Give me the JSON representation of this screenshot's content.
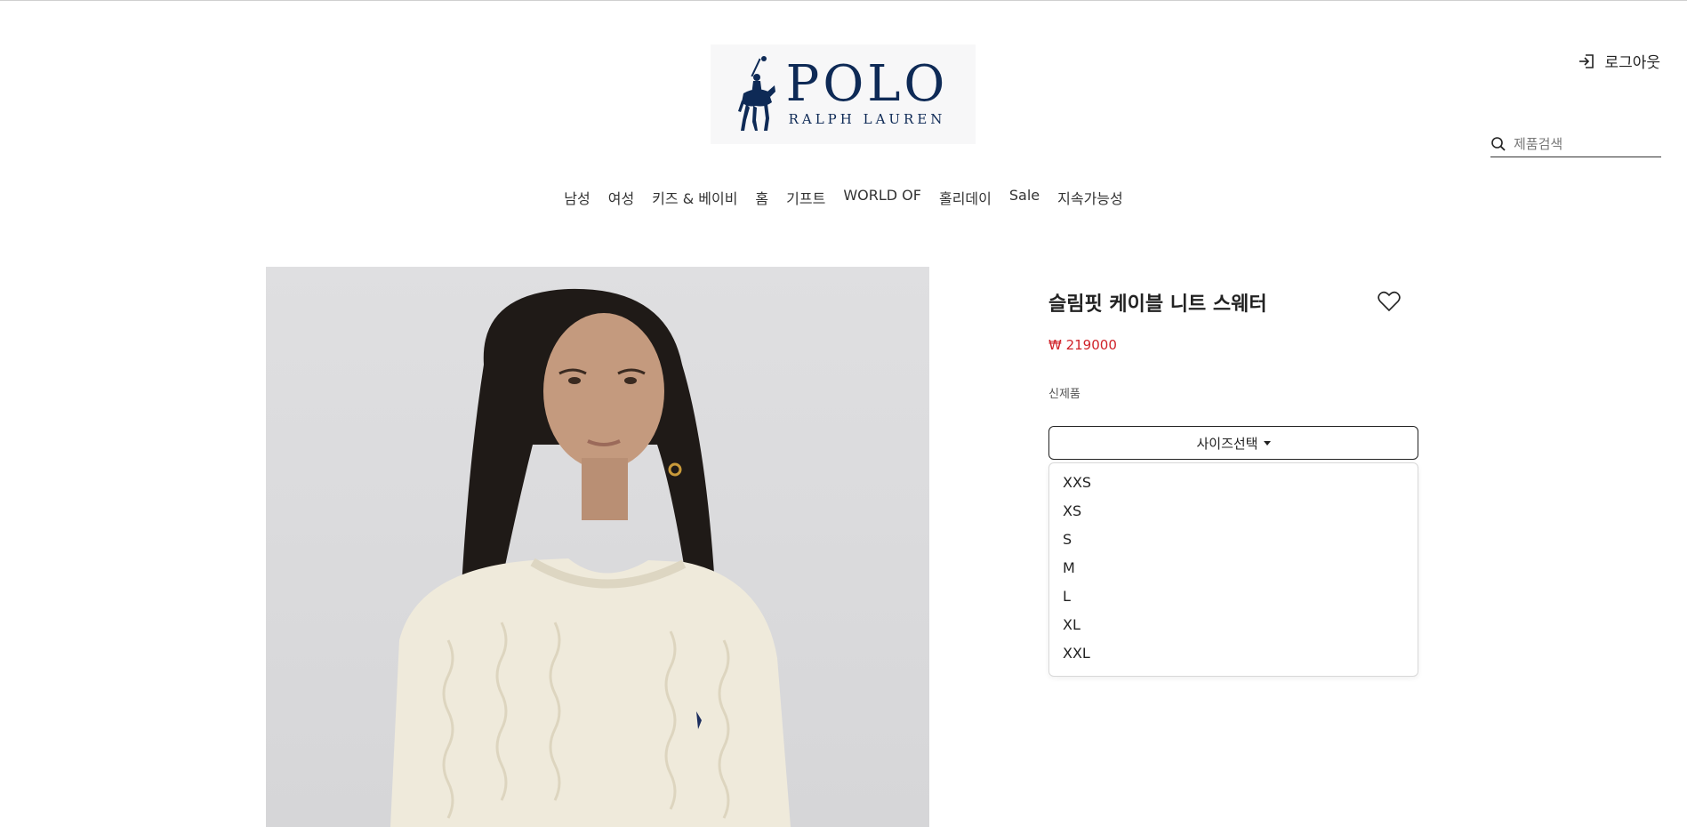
{
  "brand": {
    "line1": "POLO",
    "line2": "RALPH LAUREN",
    "color": "#0e2a56"
  },
  "header": {
    "logout_label": "로그아웃",
    "logout_icon": "sign-in-icon"
  },
  "search": {
    "placeholder": "제품검색",
    "value": "",
    "icon": "search-icon"
  },
  "nav": {
    "items": [
      "남성",
      "여성",
      "키즈 & 베이비",
      "홈",
      "기프트",
      "WORLD OF",
      "홀리데이",
      "Sale",
      "지속가능성"
    ]
  },
  "product": {
    "title": "슬림핏 케이블 니트 스웨터",
    "price": "₩ 219000",
    "badge": "신제품",
    "size_button_label": "사이즈선택",
    "sizes": [
      "XXS",
      "XS",
      "S",
      "M",
      "L",
      "XL",
      "XXL"
    ],
    "price_color": "#d0232a"
  }
}
